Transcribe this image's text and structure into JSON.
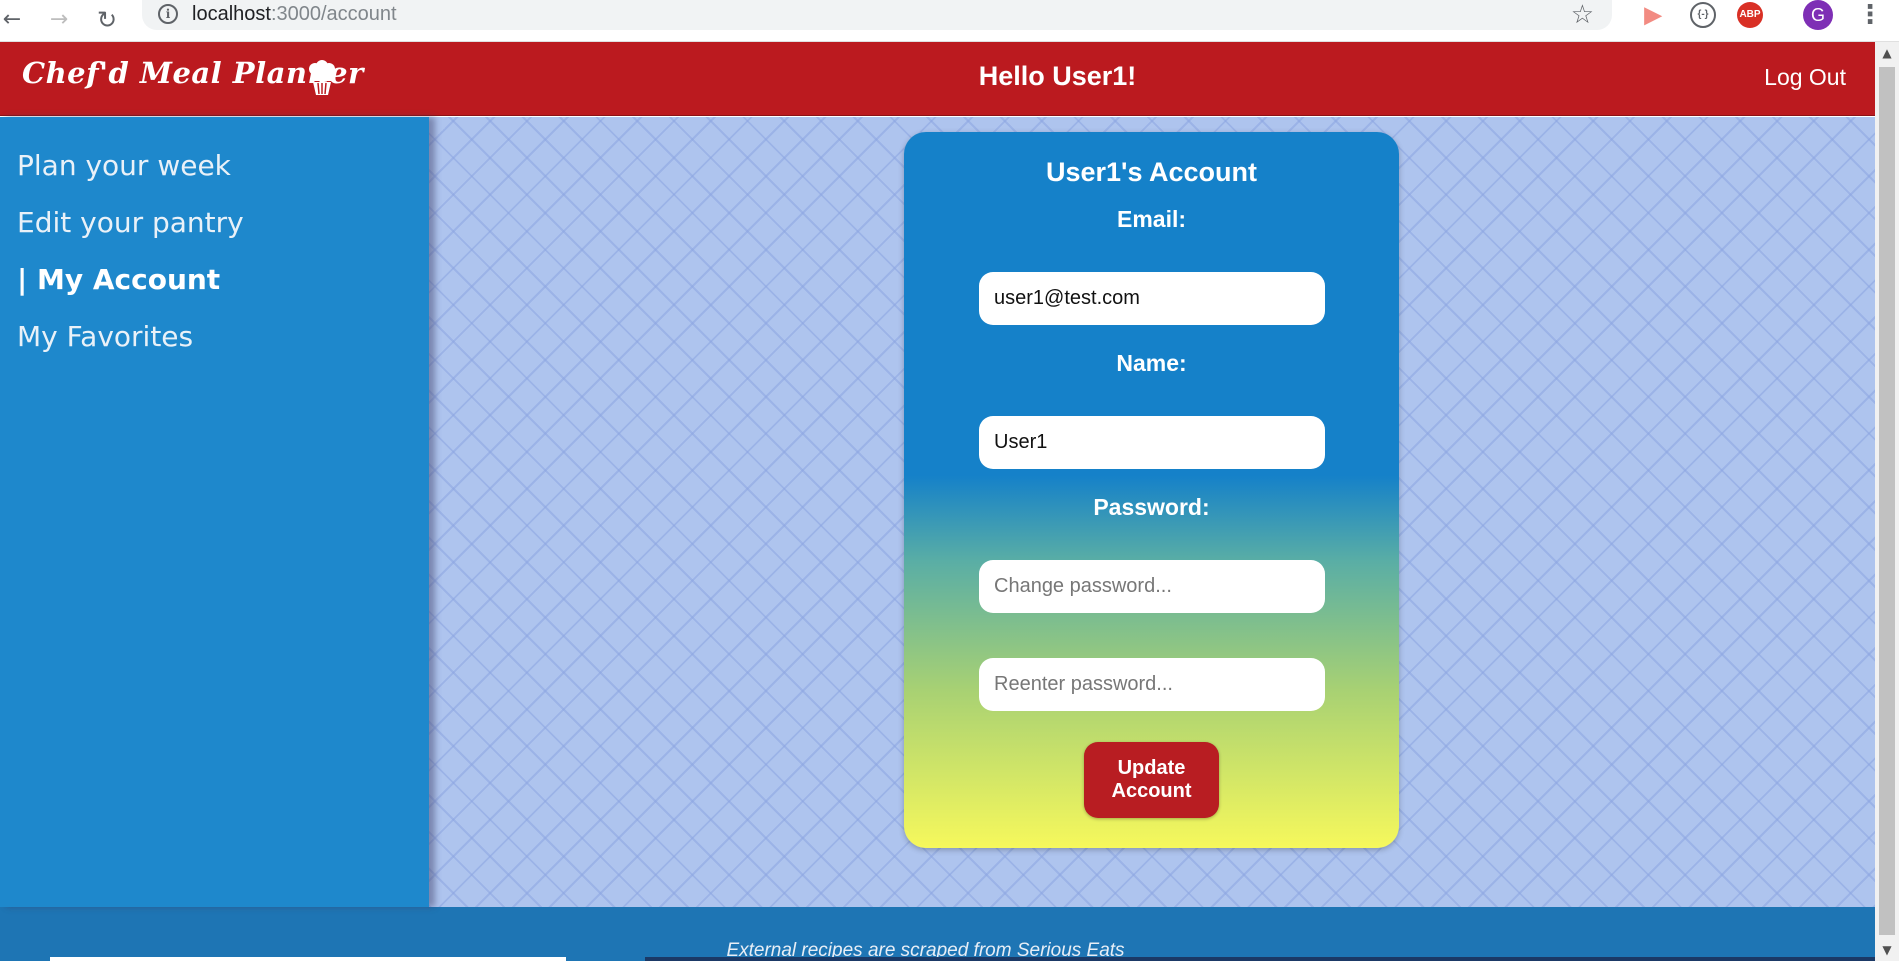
{
  "browser": {
    "url_host": "localhost",
    "url_rest": ":3000/account",
    "info_symbol": "i",
    "ext_abp": "ABP",
    "ext_dev": "{-}",
    "profile_initial": "G"
  },
  "header": {
    "brand": "Chef'd Meal Planner",
    "greeting": "Hello User1!",
    "logout": "Log Out"
  },
  "sidebar": {
    "items": [
      {
        "label": "Plan your week"
      },
      {
        "label": "Edit your pantry"
      },
      {
        "label": "| My Account",
        "active": true
      },
      {
        "label": "My Favorites"
      }
    ]
  },
  "account": {
    "title": "User1's Account",
    "email_label": "Email:",
    "email_value": "user1@test.com",
    "name_label": "Name:",
    "name_value": "User1",
    "password_label": "Password:",
    "password_placeholder": "Change password...",
    "reenter_placeholder": "Reenter password...",
    "update_button": "Update Account"
  },
  "footer": {
    "text": "External recipes are scraped from Serious Eats"
  },
  "colors": {
    "header_red": "#bb1a1f",
    "sidebar_blue": "#1e88cc",
    "content_bg": "#aec4ee",
    "card_top": "#1581c9",
    "card_bottom": "#f6f85c",
    "button_red": "#b81d22"
  }
}
